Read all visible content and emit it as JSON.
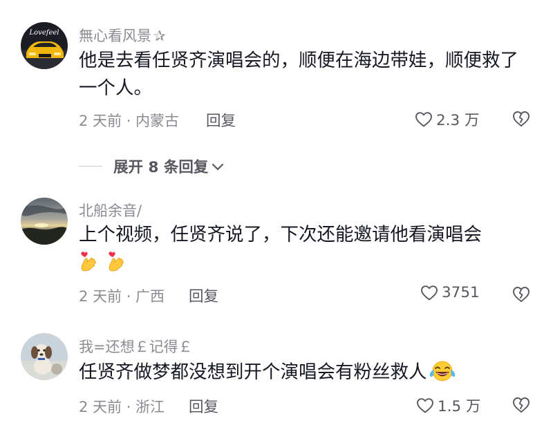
{
  "comments": [
    {
      "username": "無心看风景",
      "name_suffix": "✰",
      "text": "他是去看任贤齐演唱会的，顺便在海边带娃，顺便救了一个人。",
      "meta": "2 天前 · 内蒙古",
      "reply_label": "回复",
      "likes": "2.3 万",
      "avatar_text": "Lovefeel",
      "expand_label": "展开 8 条回复"
    },
    {
      "username": "北船余音/",
      "text": "上个视频，任贤齐说了，下次还能邀请他看演唱会",
      "emojis": [
        "finger-heart-emoji",
        "finger-heart-emoji"
      ],
      "meta": "2 天前 · 广西",
      "reply_label": "回复",
      "likes": "3751"
    },
    {
      "username": "我=还想￡记得￡",
      "text": "任贤齐做梦都没想到开个演唱会有粉丝救人",
      "emojis": [
        "tears-of-joy-emoji"
      ],
      "meta": "2 天前 · 浙江",
      "reply_label": "回复",
      "likes": "1.5 万"
    }
  ],
  "colors": {
    "text_primary": "#161823",
    "text_secondary": "#8a8b91",
    "text_action": "#57585f"
  },
  "icons": {
    "like": "heart-outline-icon",
    "dislike": "broken-heart-icon",
    "expand": "chevron-down-icon"
  }
}
